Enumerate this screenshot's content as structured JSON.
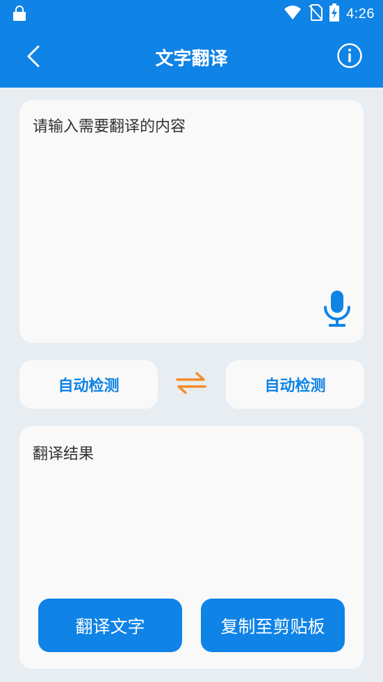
{
  "status_bar": {
    "time": "4:26",
    "icons": [
      "shopping-bag-icon",
      "wifi-icon",
      "no-sim-icon",
      "battery-charging-icon"
    ]
  },
  "app_bar": {
    "title": "文字翻译",
    "back_icon": "back-chevron-icon",
    "info_icon": "info-icon"
  },
  "input": {
    "placeholder": "请输入需要翻译的内容",
    "value": "",
    "mic_icon": "microphone-icon"
  },
  "languages": {
    "source": "自动检测",
    "target": "自动检测",
    "swap_icon": "swap-arrows-icon"
  },
  "result": {
    "text": "翻译结果"
  },
  "actions": {
    "translate_label": "翻译文字",
    "copy_label": "复制至剪贴板"
  },
  "colors": {
    "primary": "#0f83e6",
    "swap_accent": "#f28c28",
    "background": "#e8edf2",
    "card": "#f9f9f9"
  }
}
